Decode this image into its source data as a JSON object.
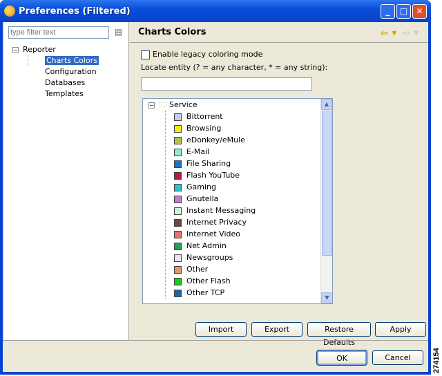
{
  "window": {
    "title": "Preferences (Filtered)"
  },
  "left": {
    "filter_placeholder": "type filter text",
    "tree": {
      "root": "Reporter",
      "children": [
        "Charts Colors",
        "Configuration",
        "Databases",
        "Templates"
      ],
      "selected": "Charts Colors"
    }
  },
  "page": {
    "title": "Charts Colors",
    "legacy_label": "Enable legacy coloring mode",
    "legacy_checked": false,
    "locate_label": "Locate entity (? = any character, * = any string):",
    "locate_value": ""
  },
  "list": {
    "group": "Service",
    "items": [
      {
        "label": "Bittorrent",
        "color": "#c8c8f0"
      },
      {
        "label": "Browsing",
        "color": "#f0f000"
      },
      {
        "label": "eDonkey/eMule",
        "color": "#b4c050"
      },
      {
        "label": "E-Mail",
        "color": "#90f0c0"
      },
      {
        "label": "File Sharing",
        "color": "#1478c8"
      },
      {
        "label": "Flash YouTube",
        "color": "#b41e3c"
      },
      {
        "label": "Gaming",
        "color": "#32c0c8"
      },
      {
        "label": "Gnutella",
        "color": "#c080c8"
      },
      {
        "label": "Instant Messaging",
        "color": "#c8f8d0"
      },
      {
        "label": "Internet Privacy",
        "color": "#6e4646"
      },
      {
        "label": "Internet Video",
        "color": "#f06e6e"
      },
      {
        "label": "Net Admin",
        "color": "#28a050"
      },
      {
        "label": "Newsgroups",
        "color": "#f0e0f0"
      },
      {
        "label": "Other",
        "color": "#e0966e"
      },
      {
        "label": "Other Flash",
        "color": "#1ec81e"
      },
      {
        "label": "Other TCP",
        "color": "#2864a0"
      }
    ]
  },
  "buttons": {
    "import": "Import",
    "export": "Export",
    "restore": "Restore Defaults",
    "apply": "Apply",
    "ok": "OK",
    "cancel": "Cancel"
  },
  "stamp": "274154"
}
